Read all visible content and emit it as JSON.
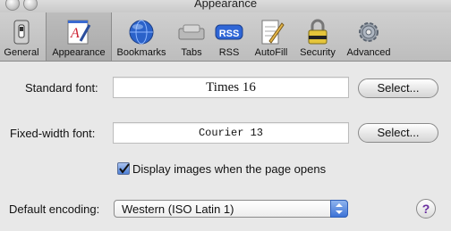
{
  "window": {
    "title": "Appearance"
  },
  "toolbar": {
    "items": [
      {
        "label": "General",
        "icon": "switch-icon",
        "selected": false
      },
      {
        "label": "Appearance",
        "icon": "font-sheet-icon",
        "selected": true
      },
      {
        "label": "Bookmarks",
        "icon": "globe-icon",
        "selected": false
      },
      {
        "label": "Tabs",
        "icon": "tabs-icon",
        "selected": false
      },
      {
        "label": "RSS",
        "icon": "rss-icon",
        "selected": false,
        "badge_text": "RSS"
      },
      {
        "label": "AutoFill",
        "icon": "pencil-form-icon",
        "selected": false
      },
      {
        "label": "Security",
        "icon": "padlock-icon",
        "selected": false
      },
      {
        "label": "Advanced",
        "icon": "gear-icon",
        "selected": false
      }
    ]
  },
  "settings": {
    "standard_font": {
      "label": "Standard font:",
      "value": "Times 16",
      "button": "Select..."
    },
    "fixed_width_font": {
      "label": "Fixed-width font:",
      "value": "Courier 13",
      "button": "Select..."
    },
    "display_images": {
      "label": "Display images when the page opens",
      "checked": true
    },
    "default_encoding": {
      "label": "Default encoding:",
      "value": "Western (ISO Latin 1)"
    },
    "help": {
      "glyph": "?"
    }
  },
  "colors": {
    "accent": "#3e73d6",
    "help_glyph": "#6a2ea0"
  }
}
